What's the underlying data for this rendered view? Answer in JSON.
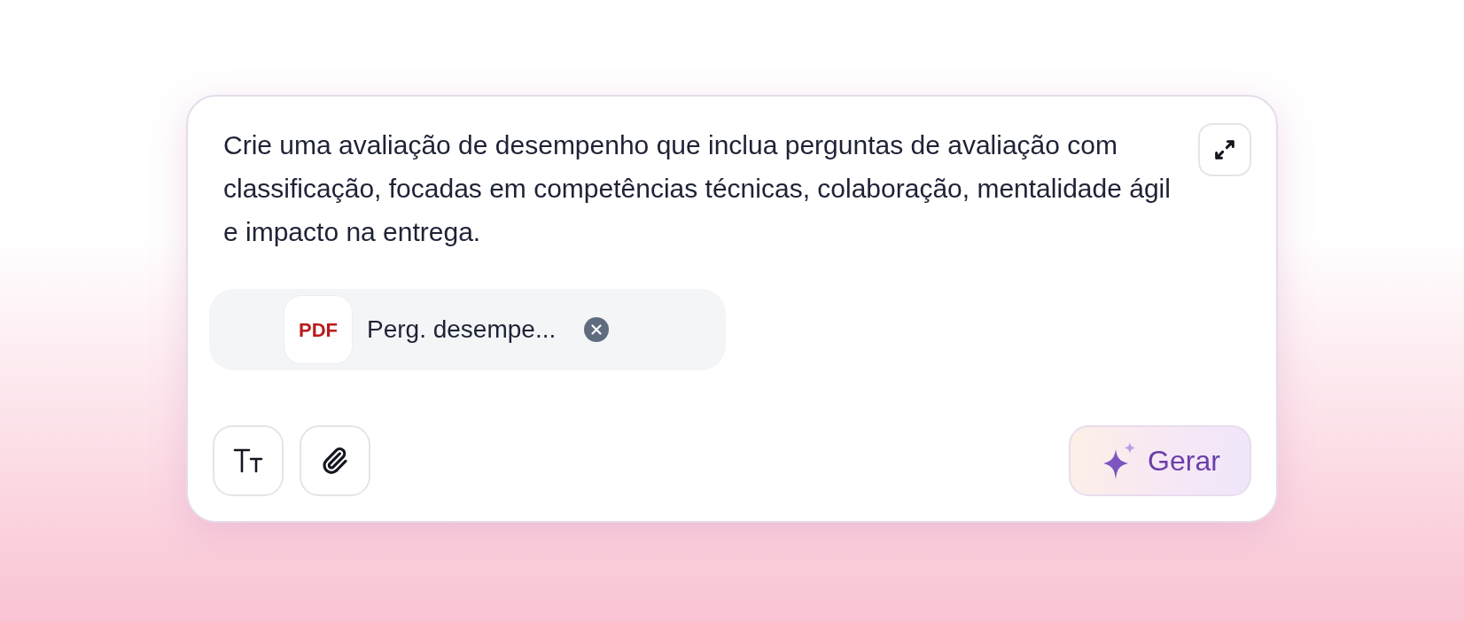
{
  "prompt": {
    "value": "Crie uma avaliação de desempenho que inclua perguntas de avaliação com classificação, focadas em competências técnicas, colaboração, mentalidade ágil e impacto na entrega."
  },
  "attachments": [
    {
      "kind": "pdf",
      "badge": "PDF",
      "name": "Perg. desempe..."
    }
  ],
  "generate_button": {
    "label": "Gerar"
  }
}
